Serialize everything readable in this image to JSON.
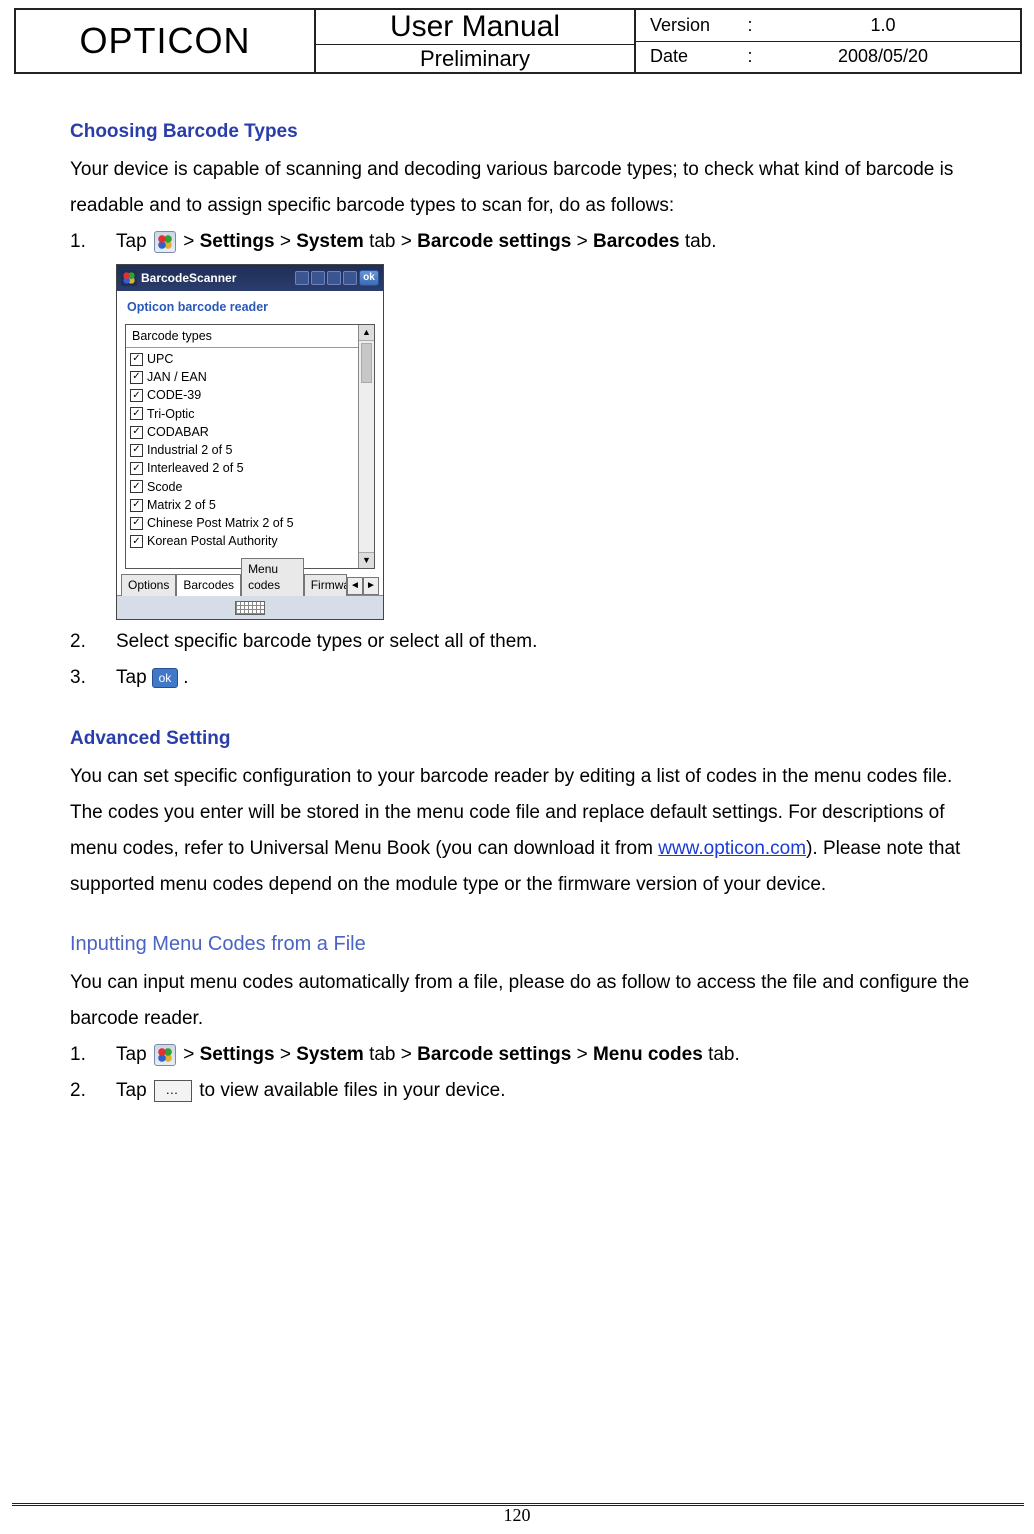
{
  "header": {
    "brand": "OPTICON",
    "title": "User Manual",
    "subtitle": "Preliminary",
    "version_label": "Version",
    "date_label": "Date",
    "colon": ":",
    "version_value": "1.0",
    "date_value": "2008/05/20"
  },
  "section1": {
    "heading": "Choosing Barcode Types",
    "intro": "Your device is capable of scanning and decoding various barcode types; to check what kind of barcode is readable and to assign specific barcode types to scan for, do as follows:",
    "step1_num": "1.",
    "step1_pre": "Tap ",
    "step1_gt1": " > ",
    "step1_b1": "Settings",
    "step1_gt2": " > ",
    "step1_b2": "System",
    "step1_after_b2": " tab > ",
    "step1_b3": "Barcode settings",
    "step1_gt3": " > ",
    "step1_b4": "Barcodes",
    "step1_after_b4": " tab.",
    "step2_num": "2.",
    "step2_text": "Select specific barcode types or select all of them.",
    "step3_num": "3.",
    "step3_pre": "Tap ",
    "step3_post": "."
  },
  "screenshot": {
    "title": "BarcodeScanner",
    "subheader": "Opticon barcode reader",
    "panel_title": "Barcode types",
    "ok_label": "ok",
    "items": [
      "UPC",
      "JAN / EAN",
      "CODE-39",
      "Tri-Optic",
      "CODABAR",
      "Industrial 2 of 5",
      "Interleaved 2 of 5",
      "Scode",
      "Matrix 2 of 5",
      "Chinese Post Matrix 2 of 5",
      "Korean Postal Authority"
    ],
    "tabs": [
      "Options",
      "Barcodes",
      "Menu codes",
      "Firmwa"
    ]
  },
  "section2": {
    "heading": "Advanced Setting",
    "para_pre": "You can set specific configuration to your barcode reader by editing a list of codes in the menu codes file. The codes you enter will be stored in the menu code file and replace default settings. For descriptions of menu codes, refer to Universal Menu Book (you can download it from ",
    "link": "www.opticon.com",
    "para_post": "). Please note that supported menu codes depend on the module type or the firmware version of your device."
  },
  "section3": {
    "heading": "Inputting Menu Codes from a File",
    "intro": "You can input menu codes automatically from a file, please do as follow to access the file and configure the barcode reader.",
    "step1_num": "1.",
    "step1_pre": "Tap ",
    "step1_gt1": " > ",
    "step1_b1": "Settings",
    "step1_gt2": " > ",
    "step1_b2": "System",
    "step1_after_b2": " tab > ",
    "step1_b3": "Barcode settings",
    "step1_gt3": " > ",
    "step1_b4": "Menu codes",
    "step1_after_b4": " tab.",
    "step2_num": "2.",
    "step2_pre": "Tap ",
    "step2_post": " to view available files in your device.",
    "dots": "…"
  },
  "page_number": "120"
}
